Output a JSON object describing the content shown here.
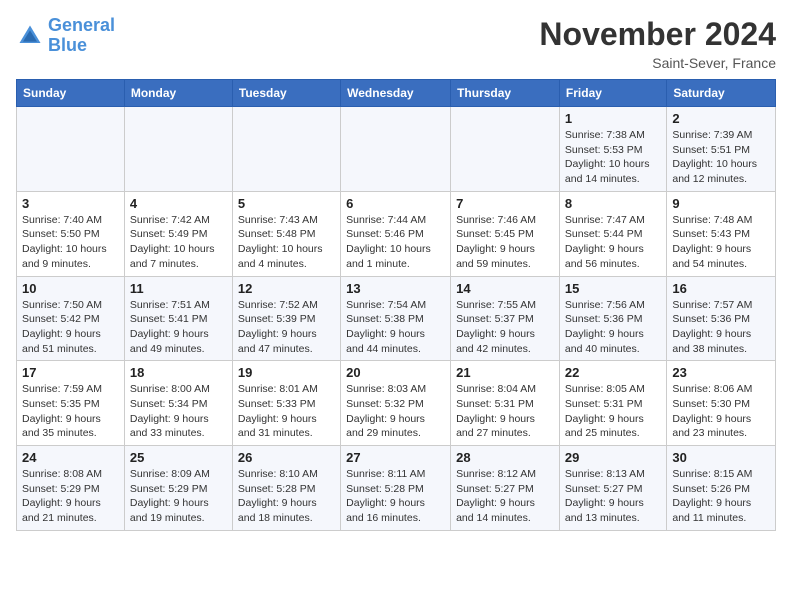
{
  "header": {
    "logo_line1": "General",
    "logo_line2": "Blue",
    "month_title": "November 2024",
    "location": "Saint-Sever, France"
  },
  "days_of_week": [
    "Sunday",
    "Monday",
    "Tuesday",
    "Wednesday",
    "Thursday",
    "Friday",
    "Saturday"
  ],
  "weeks": [
    [
      {
        "day": "",
        "info": ""
      },
      {
        "day": "",
        "info": ""
      },
      {
        "day": "",
        "info": ""
      },
      {
        "day": "",
        "info": ""
      },
      {
        "day": "",
        "info": ""
      },
      {
        "day": "1",
        "info": "Sunrise: 7:38 AM\nSunset: 5:53 PM\nDaylight: 10 hours and 14 minutes."
      },
      {
        "day": "2",
        "info": "Sunrise: 7:39 AM\nSunset: 5:51 PM\nDaylight: 10 hours and 12 minutes."
      }
    ],
    [
      {
        "day": "3",
        "info": "Sunrise: 7:40 AM\nSunset: 5:50 PM\nDaylight: 10 hours and 9 minutes."
      },
      {
        "day": "4",
        "info": "Sunrise: 7:42 AM\nSunset: 5:49 PM\nDaylight: 10 hours and 7 minutes."
      },
      {
        "day": "5",
        "info": "Sunrise: 7:43 AM\nSunset: 5:48 PM\nDaylight: 10 hours and 4 minutes."
      },
      {
        "day": "6",
        "info": "Sunrise: 7:44 AM\nSunset: 5:46 PM\nDaylight: 10 hours and 1 minute."
      },
      {
        "day": "7",
        "info": "Sunrise: 7:46 AM\nSunset: 5:45 PM\nDaylight: 9 hours and 59 minutes."
      },
      {
        "day": "8",
        "info": "Sunrise: 7:47 AM\nSunset: 5:44 PM\nDaylight: 9 hours and 56 minutes."
      },
      {
        "day": "9",
        "info": "Sunrise: 7:48 AM\nSunset: 5:43 PM\nDaylight: 9 hours and 54 minutes."
      }
    ],
    [
      {
        "day": "10",
        "info": "Sunrise: 7:50 AM\nSunset: 5:42 PM\nDaylight: 9 hours and 51 minutes."
      },
      {
        "day": "11",
        "info": "Sunrise: 7:51 AM\nSunset: 5:41 PM\nDaylight: 9 hours and 49 minutes."
      },
      {
        "day": "12",
        "info": "Sunrise: 7:52 AM\nSunset: 5:39 PM\nDaylight: 9 hours and 47 minutes."
      },
      {
        "day": "13",
        "info": "Sunrise: 7:54 AM\nSunset: 5:38 PM\nDaylight: 9 hours and 44 minutes."
      },
      {
        "day": "14",
        "info": "Sunrise: 7:55 AM\nSunset: 5:37 PM\nDaylight: 9 hours and 42 minutes."
      },
      {
        "day": "15",
        "info": "Sunrise: 7:56 AM\nSunset: 5:36 PM\nDaylight: 9 hours and 40 minutes."
      },
      {
        "day": "16",
        "info": "Sunrise: 7:57 AM\nSunset: 5:36 PM\nDaylight: 9 hours and 38 minutes."
      }
    ],
    [
      {
        "day": "17",
        "info": "Sunrise: 7:59 AM\nSunset: 5:35 PM\nDaylight: 9 hours and 35 minutes."
      },
      {
        "day": "18",
        "info": "Sunrise: 8:00 AM\nSunset: 5:34 PM\nDaylight: 9 hours and 33 minutes."
      },
      {
        "day": "19",
        "info": "Sunrise: 8:01 AM\nSunset: 5:33 PM\nDaylight: 9 hours and 31 minutes."
      },
      {
        "day": "20",
        "info": "Sunrise: 8:03 AM\nSunset: 5:32 PM\nDaylight: 9 hours and 29 minutes."
      },
      {
        "day": "21",
        "info": "Sunrise: 8:04 AM\nSunset: 5:31 PM\nDaylight: 9 hours and 27 minutes."
      },
      {
        "day": "22",
        "info": "Sunrise: 8:05 AM\nSunset: 5:31 PM\nDaylight: 9 hours and 25 minutes."
      },
      {
        "day": "23",
        "info": "Sunrise: 8:06 AM\nSunset: 5:30 PM\nDaylight: 9 hours and 23 minutes."
      }
    ],
    [
      {
        "day": "24",
        "info": "Sunrise: 8:08 AM\nSunset: 5:29 PM\nDaylight: 9 hours and 21 minutes."
      },
      {
        "day": "25",
        "info": "Sunrise: 8:09 AM\nSunset: 5:29 PM\nDaylight: 9 hours and 19 minutes."
      },
      {
        "day": "26",
        "info": "Sunrise: 8:10 AM\nSunset: 5:28 PM\nDaylight: 9 hours and 18 minutes."
      },
      {
        "day": "27",
        "info": "Sunrise: 8:11 AM\nSunset: 5:28 PM\nDaylight: 9 hours and 16 minutes."
      },
      {
        "day": "28",
        "info": "Sunrise: 8:12 AM\nSunset: 5:27 PM\nDaylight: 9 hours and 14 minutes."
      },
      {
        "day": "29",
        "info": "Sunrise: 8:13 AM\nSunset: 5:27 PM\nDaylight: 9 hours and 13 minutes."
      },
      {
        "day": "30",
        "info": "Sunrise: 8:15 AM\nSunset: 5:26 PM\nDaylight: 9 hours and 11 minutes."
      }
    ]
  ]
}
